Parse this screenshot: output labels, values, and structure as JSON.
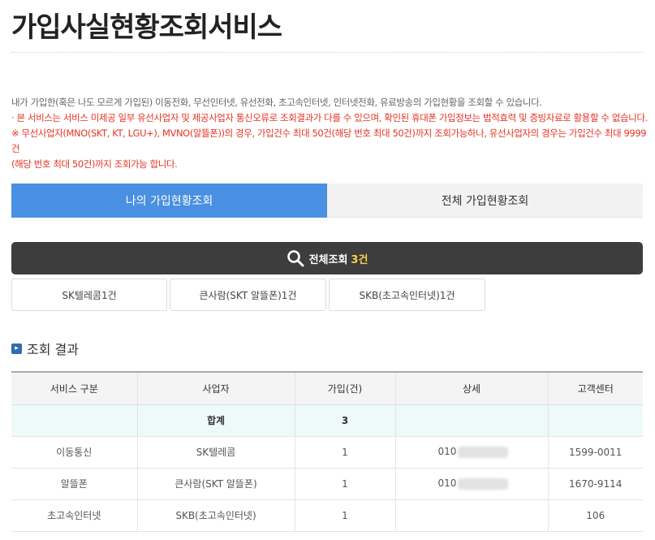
{
  "page": {
    "title": "가입사실현황조회서비스"
  },
  "description": {
    "line1": "내가 가입한(혹은 나도 모르게 가입된) 이동전화, 무선인터넷, 유선전화, 초고속인터넷, 인터넷전화, 유료방송의 가입현황을 조회할 수 있습니다.",
    "line2": "· 본 서비스는 서비스 미제공 일부 유선사업자 및 제공사업자 통신오류로 조회결과가 다를 수 있으며, 확인된 휴대폰 가입정보는 법적효력 및 증빙자료로 활용할 수 없습니다.",
    "line3": "※ 무선사업자(MNO(SKT, KT, LGU+), MVNO(알뜰폰))의 경우, 가입건수 최대 50건(해당 번호 최대 50건)까지 조회가능하나, 유선사업자의 경우는 가입건수 최대 9999건",
    "line4": "(해당 번호 최대 50건)까지 조회가능 합니다."
  },
  "tabs": [
    {
      "label": "나의 가입현황조회",
      "active": true
    },
    {
      "label": "전체 가입현황조회",
      "active": false
    }
  ],
  "search_bar": {
    "label": "전체조회",
    "count": "3건",
    "icon": "search-icon"
  },
  "chips": [
    {
      "label": "SK텔레콤1건"
    },
    {
      "label": "큰사람(SKT 알뜰폰)1건"
    },
    {
      "label": "SKB(초고속인터넷)1건"
    }
  ],
  "result_section": {
    "title": "조회 결과",
    "icon": "chevron-right-icon"
  },
  "table": {
    "headers": [
      "서비스 구분",
      "사업자",
      "가입(건)",
      "상세",
      "고객센터"
    ],
    "total": {
      "label": "합계",
      "count": "3"
    },
    "rows": [
      {
        "service": "이동통신",
        "carrier": "SK텔레콤",
        "count": "1",
        "detail": "010",
        "center": "1599-0011"
      },
      {
        "service": "알뜰폰",
        "carrier": "큰사람(SKT 알뜰폰)",
        "count": "1",
        "detail": "010",
        "center": "1670-9114"
      },
      {
        "service": "초고속인터넷",
        "carrier": "SKB(초고속인터넷)",
        "count": "1",
        "detail": "",
        "center": "106"
      }
    ]
  },
  "colors": {
    "accent": "#4a90e2",
    "dark_bar": "#3d3d3d",
    "warning": "#e63323",
    "count_highlight": "#f7d24a",
    "total_row_bg": "#eefafa"
  }
}
